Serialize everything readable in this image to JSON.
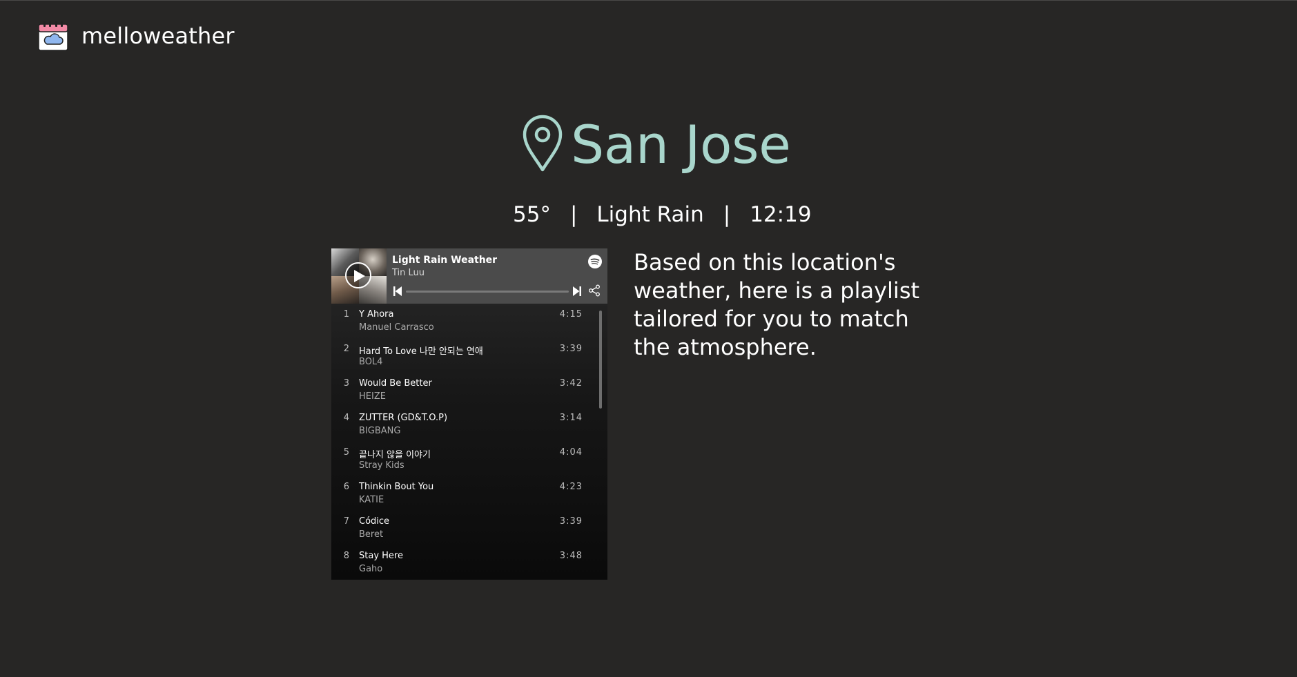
{
  "app": {
    "name": "melloweather",
    "logo_icon": "calendar-cloud-icon"
  },
  "location": {
    "city": "San Jose",
    "icon": "map-pin-icon",
    "accent_color": "#a9d6cc"
  },
  "weather": {
    "temperature": "55°",
    "separator": "|",
    "condition": "Light Rain",
    "time": "12:19"
  },
  "playlist": {
    "title": "Light Rain Weather",
    "owner": "Tin Luu",
    "progress": 0,
    "tracks": [
      {
        "number": "1",
        "title": "Y Ahora",
        "artist": "Manuel Carrasco",
        "duration": "4:15"
      },
      {
        "number": "2",
        "title": "Hard To Love 나만 안되는 연애",
        "artist": "BOL4",
        "duration": "3:39"
      },
      {
        "number": "3",
        "title": "Would Be Better",
        "artist": "HEIZE",
        "duration": "3:42"
      },
      {
        "number": "4",
        "title": "ZUTTER (GD&T.O.P)",
        "artist": "BIGBANG",
        "duration": "3:14"
      },
      {
        "number": "5",
        "title": "끝나지 않을 이야기",
        "artist": "Stray Kids",
        "duration": "4:04"
      },
      {
        "number": "6",
        "title": "Thinkin Bout You",
        "artist": "KATIE",
        "duration": "4:23"
      },
      {
        "number": "7",
        "title": "Códice",
        "artist": "Beret",
        "duration": "3:39"
      },
      {
        "number": "8",
        "title": "Stay Here",
        "artist": "Gaho",
        "duration": "3:48"
      }
    ]
  },
  "description": "Based on this location's weather, here is a playlist tailored for you to match the atmosphere."
}
